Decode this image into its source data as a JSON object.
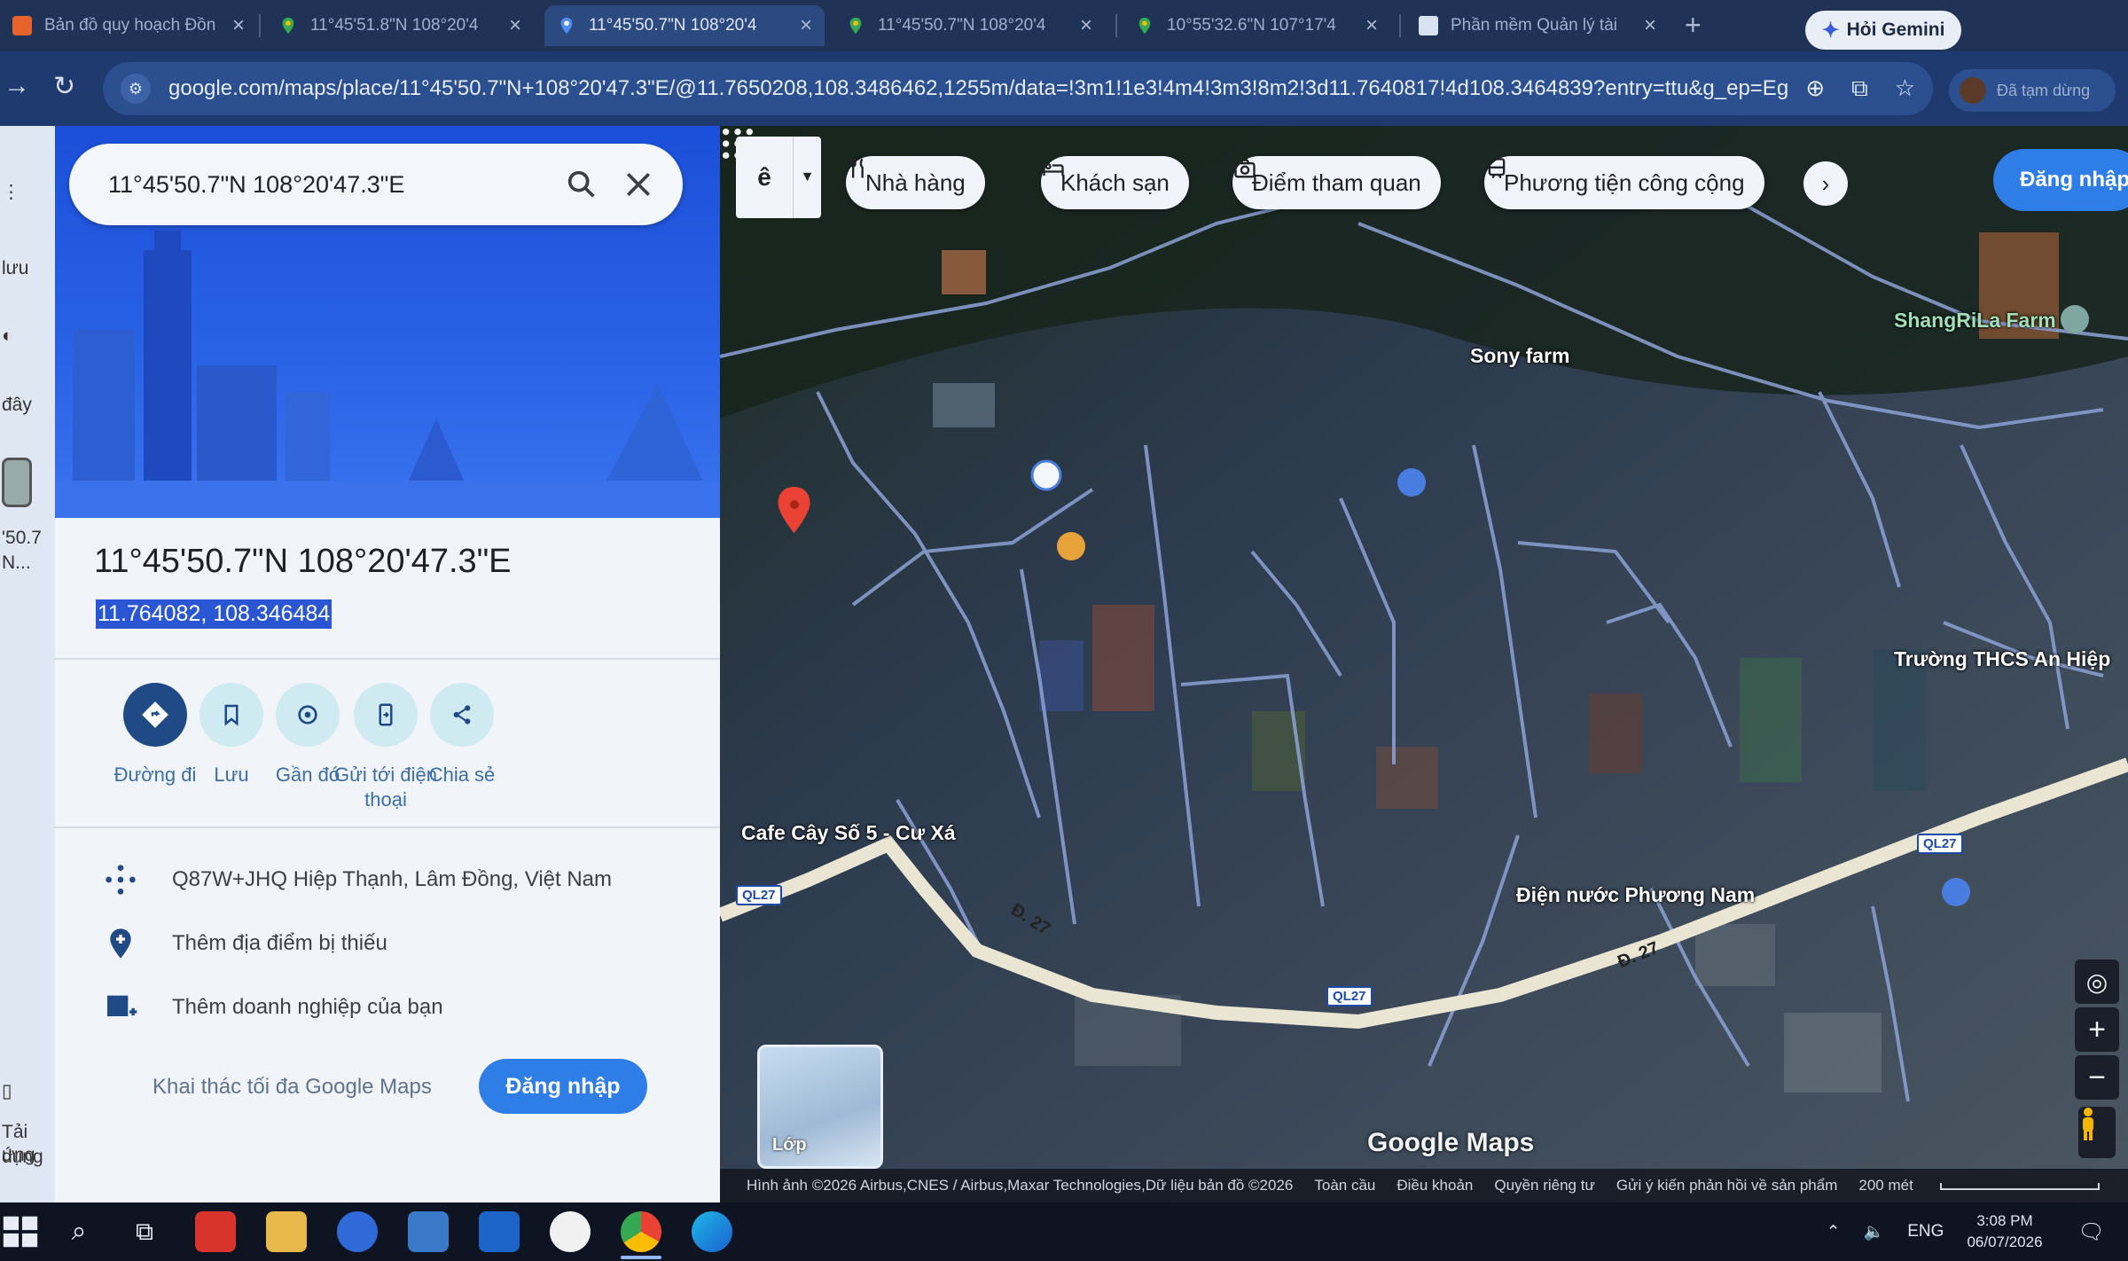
{
  "browser": {
    "tabs": [
      {
        "title": "Bản đồ quy hoạch Đồn",
        "active": false
      },
      {
        "title": "11°45'51.8\"N 108°20'4",
        "active": false
      },
      {
        "title": "11°45'50.7\"N 108°20'4",
        "active": true
      },
      {
        "title": "11°45'50.7\"N 108°20'4",
        "active": false
      },
      {
        "title": "10°55'32.6\"N 107°17'4",
        "active": false
      },
      {
        "title": "Phần mềm Quản lý tài",
        "active": false
      }
    ],
    "new_tab_label": "+",
    "gemini_label": "Hỏi Gemini",
    "url": "google.com/maps/place/11°45'50.7\"N+108°20'47.3\"E/@11.7650208,108.3486462,1255m/data=!3m1!1e3!4m4!3m3!8m2!3d11.7640817!4d108.3464839?entry=ttu&g_ep=Egoy...",
    "profile_label": "Đã tạm dừng"
  },
  "rail": {
    "items": [
      "lưu",
      "đây",
      "'50.7",
      "N...",
      "Tải ứng",
      "dụng"
    ]
  },
  "panel": {
    "search_value": "11°45'50.7\"N 108°20'47.3\"E",
    "title": "11°45'50.7\"N 108°20'47.3\"E",
    "decimal_coords": "11.764082, 108.346484",
    "actions": [
      {
        "label": "Đường đi"
      },
      {
        "label": "Lưu"
      },
      {
        "label": "Gần đó"
      },
      {
        "label": "Gửi tới điện thoại"
      },
      {
        "label": "Chia sẻ"
      }
    ],
    "plus_code": "Q87W+JHQ Hiệp Thạnh, Lâm Đồng, Việt Nam",
    "add_missing_place": "Thêm địa điểm bị thiếu",
    "add_business": "Thêm doanh nghiệp của bạn",
    "footer_text": "Khai thác tối đa Google Maps",
    "signin_label": "Đăng nhập"
  },
  "map": {
    "layer_selector_label": "ê",
    "chips": [
      {
        "label": "Nhà hàng",
        "icon": "restaurant-icon"
      },
      {
        "label": "Khách sạn",
        "icon": "hotel-icon"
      },
      {
        "label": "Điểm tham quan",
        "icon": "camera-icon"
      },
      {
        "label": "Phương tiện công cộng",
        "icon": "transit-icon"
      }
    ],
    "signin_label": "Đăng nhập",
    "labels": {
      "sony_farm": "Sony farm",
      "shangrila": "ShangRiLa Farm",
      "thcs": "Trường THCS An Hiệp",
      "cafe": "Cafe Cây Số 5 - Cư Xá",
      "dien_nuoc": "Điện nước Phương Nam"
    },
    "road_shields": [
      "QL27",
      "QL27",
      "QL27"
    ],
    "road_names": [
      "Đ. 27",
      "Đ. 27"
    ],
    "layers_label": "Lớp",
    "brand": "Google Maps",
    "footer": {
      "attribution": "Hình ảnh ©2026 Airbus,CNES / Airbus,Maxar Technologies,Dữ liệu bản đồ ©2026",
      "global": "Toàn cầu",
      "terms": "Điều khoản",
      "privacy": "Quyền riêng tư",
      "feedback": "Gửi ý kiến phản hồi về sản phẩm",
      "scale": "200 mét"
    }
  },
  "taskbar": {
    "lang": "ENG",
    "time": "3:08 PM",
    "date": "06/07/2026"
  }
}
